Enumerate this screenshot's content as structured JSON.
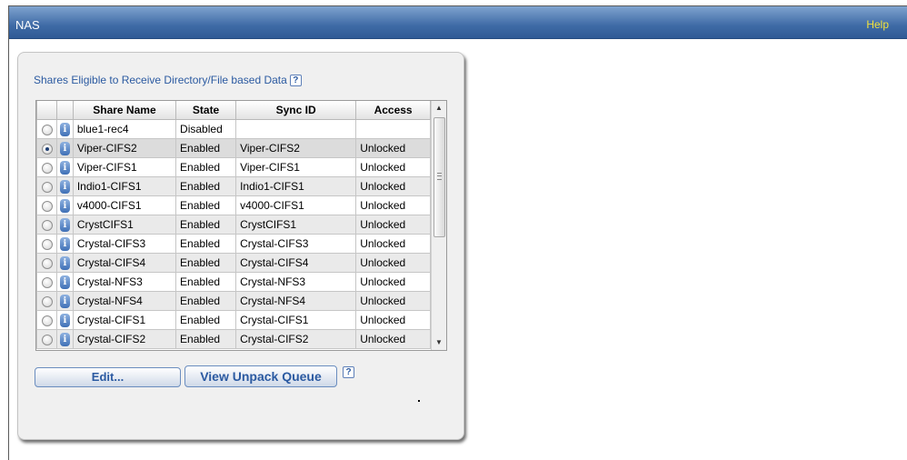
{
  "header": {
    "title": "NAS",
    "help_label": "Help"
  },
  "panel": {
    "heading": "Shares Eligible to Receive Directory/File based Data",
    "help_icon": "?",
    "columns": [
      "",
      "",
      "Share Name",
      "State",
      "Sync ID",
      "Access"
    ],
    "rows": [
      {
        "name": "blue1-rec4",
        "state": "Disabled",
        "sync_id": "",
        "access": ""
      },
      {
        "name": "Viper-CIFS2",
        "state": "Enabled",
        "sync_id": "Viper-CIFS2",
        "access": "Unlocked",
        "selected": true
      },
      {
        "name": "Viper-CIFS1",
        "state": "Enabled",
        "sync_id": "Viper-CIFS1",
        "access": "Unlocked"
      },
      {
        "name": "Indio1-CIFS1",
        "state": "Enabled",
        "sync_id": "Indio1-CIFS1",
        "access": "Unlocked"
      },
      {
        "name": "v4000-CIFS1",
        "state": "Enabled",
        "sync_id": "v4000-CIFS1",
        "access": "Unlocked"
      },
      {
        "name": "CrystCIFS1",
        "state": "Enabled",
        "sync_id": "CrystCIFS1",
        "access": "Unlocked"
      },
      {
        "name": "Crystal-CIFS3",
        "state": "Enabled",
        "sync_id": "Crystal-CIFS3",
        "access": "Unlocked"
      },
      {
        "name": "Crystal-CIFS4",
        "state": "Enabled",
        "sync_id": "Crystal-CIFS4",
        "access": "Unlocked"
      },
      {
        "name": "Crystal-NFS3",
        "state": "Enabled",
        "sync_id": "Crystal-NFS3",
        "access": "Unlocked"
      },
      {
        "name": "Crystal-NFS4",
        "state": "Enabled",
        "sync_id": "Crystal-NFS4",
        "access": "Unlocked"
      },
      {
        "name": "Crystal-CIFS1",
        "state": "Enabled",
        "sync_id": "Crystal-CIFS1",
        "access": "Unlocked"
      },
      {
        "name": "Crystal-CIFS2",
        "state": "Enabled",
        "sync_id": "Crystal-CIFS2",
        "access": "Unlocked"
      }
    ],
    "info_icon": "i",
    "scroll_up_icon": "▲",
    "scroll_down_icon": "▼",
    "edit_label": "Edit...",
    "unpack_label": "View Unpack Queue",
    "unpack_help_icon": "?"
  }
}
